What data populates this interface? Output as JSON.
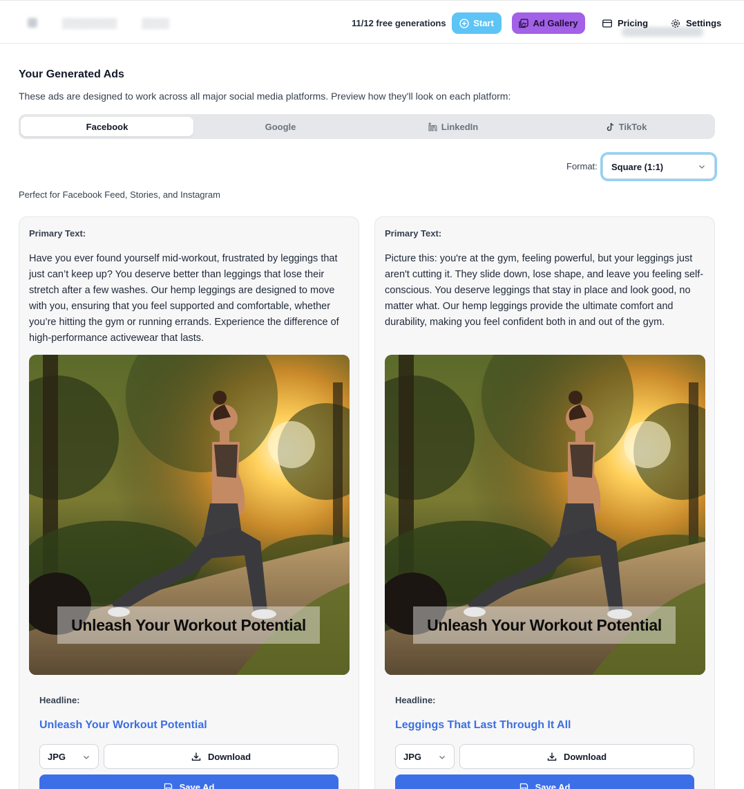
{
  "header": {
    "generations": "11/12 free generations",
    "start_label": "Start",
    "gallery_label": "Ad Gallery",
    "pricing_label": "Pricing",
    "settings_label": "Settings",
    "colors": {
      "start": "#5ec4f5",
      "gallery": "#a261e6"
    }
  },
  "intro": {
    "title": "Your Generated Ads",
    "description": "These ads are designed to work across all major social media platforms. Preview how they'll look on each platform:"
  },
  "tabs": [
    {
      "label": "Facebook",
      "active": true
    },
    {
      "label": "Google",
      "active": false
    },
    {
      "label": "LinkedIn",
      "icon": "linkedin-icon",
      "active": false
    },
    {
      "label": "TikTok",
      "icon": "tiktok-icon",
      "active": false
    }
  ],
  "format": {
    "label": "Format:",
    "value": "Square (1:1)"
  },
  "platform_note": "Perfect for Facebook Feed, Stories, and Instagram",
  "cards": [
    {
      "primary_label": "Primary Text:",
      "primary_text": "Have you ever found yourself mid-workout, frustrated by leggings that just can’t keep up? You deserve better than leggings that lose their stretch after a few washes. Our hemp leggings are designed to move with you, ensuring that you feel supported and comfortable, whether you’re hitting the gym or running errands. Experience the difference of high-performance activewear that lasts.",
      "image_caption": "Unleash Your Workout Potential",
      "headline_label": "Headline:",
      "headline": "Unleash Your Workout Potential",
      "file_format": "JPG",
      "download_label": "Download",
      "save_label": "Save Ad"
    },
    {
      "primary_label": "Primary Text:",
      "primary_text": "Picture this: you're at the gym, feeling powerful, but your leggings just aren't cutting it. They slide down, lose shape, and leave you feeling self-conscious. You deserve leggings that stay in place and look good, no matter what. Our hemp leggings provide the ultimate comfort and durability, making you feel confident both in and out of the gym.",
      "image_caption": "Unleash Your Workout Potential",
      "headline_label": "Headline:",
      "headline": "Leggings That Last Through It All",
      "file_format": "JPG",
      "download_label": "Download",
      "save_label": "Save Ad"
    }
  ]
}
